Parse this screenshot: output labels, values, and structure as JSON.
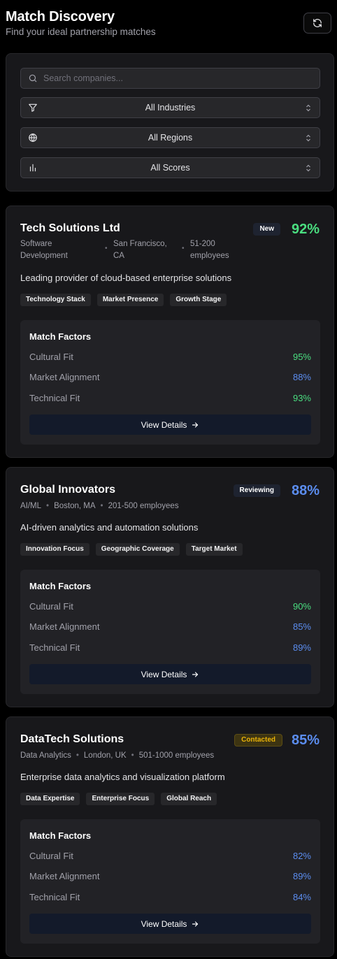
{
  "header": {
    "title": "Match Discovery",
    "subtitle": "Find your ideal partnership matches",
    "refresh_icon": "refresh-icon"
  },
  "filters": {
    "search_placeholder": "Search companies...",
    "industry": "All Industries",
    "region": "All Regions",
    "score": "All Scores"
  },
  "factors_title": "Match Factors",
  "details_label": "View Details",
  "companies": [
    {
      "name": "Tech Solutions Ltd",
      "status": "New",
      "score": "92%",
      "industry": "Software Development",
      "location": "San Francisco, CA",
      "size": "51-200 employees",
      "description": "Leading provider of cloud-based enterprise solutions",
      "tags": [
        "Technology Stack",
        "Market Presence",
        "Growth Stage"
      ],
      "factors": [
        {
          "label": "Cultural Fit",
          "value": "95%"
        },
        {
          "label": "Market Alignment",
          "value": "88%"
        },
        {
          "label": "Technical Fit",
          "value": "93%"
        }
      ]
    },
    {
      "name": "Global Innovators",
      "status": "Reviewing",
      "score": "88%",
      "industry": "AI/ML",
      "location": "Boston, MA",
      "size": "201-500 employees",
      "description": "AI-driven analytics and automation solutions",
      "tags": [
        "Innovation Focus",
        "Geographic Coverage",
        "Target Market"
      ],
      "factors": [
        {
          "label": "Cultural Fit",
          "value": "90%"
        },
        {
          "label": "Market Alignment",
          "value": "85%"
        },
        {
          "label": "Technical Fit",
          "value": "89%"
        }
      ]
    },
    {
      "name": "DataTech Solutions",
      "status": "Contacted",
      "score": "85%",
      "industry": "Data Analytics",
      "location": "London, UK",
      "size": "501-1000 employees",
      "description": "Enterprise data analytics and visualization platform",
      "tags": [
        "Data Expertise",
        "Enterprise Focus",
        "Global Reach"
      ],
      "factors": [
        {
          "label": "Cultural Fit",
          "value": "82%"
        },
        {
          "label": "Market Alignment",
          "value": "89%"
        },
        {
          "label": "Technical Fit",
          "value": "84%"
        }
      ]
    }
  ],
  "colors": {
    "high_score": "#4ade80",
    "mid_score": "#5b8def",
    "contacted_badge": "#eab308"
  }
}
